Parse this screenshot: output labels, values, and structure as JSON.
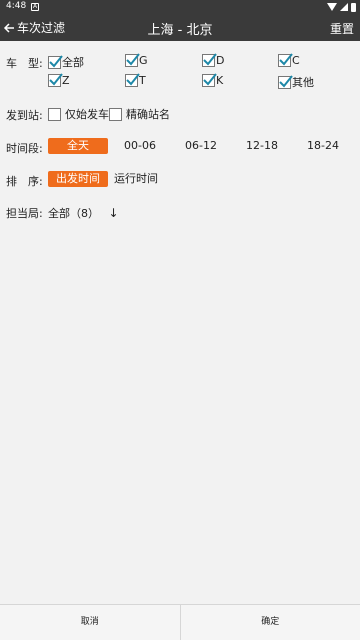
{
  "status": {
    "time": "4:48",
    "notif": "A"
  },
  "appbar": {
    "back_label": "车次过滤",
    "title": "上海 - 北京",
    "reset_label": "重置"
  },
  "train_type": {
    "label": "车　型:",
    "options": [
      {
        "label": "全部",
        "checked": true
      },
      {
        "label": "G",
        "checked": true
      },
      {
        "label": "D",
        "checked": true
      },
      {
        "label": "C",
        "checked": true
      },
      {
        "label": "Z",
        "checked": true
      },
      {
        "label": "T",
        "checked": true
      },
      {
        "label": "K",
        "checked": true
      },
      {
        "label": "其他",
        "checked": true
      }
    ]
  },
  "departure_station": {
    "label": "发到站:",
    "options": [
      {
        "label": "仅始发车",
        "checked": false
      },
      {
        "label": "精确站名",
        "checked": false
      }
    ]
  },
  "time_period": {
    "label": "时间段:",
    "options": [
      {
        "label": "全天",
        "active": true
      },
      {
        "label": "00-06",
        "active": false
      },
      {
        "label": "06-12",
        "active": false
      },
      {
        "label": "12-18",
        "active": false
      },
      {
        "label": "18-24",
        "active": false
      }
    ]
  },
  "sort": {
    "label": "排　序:",
    "options": [
      {
        "label": "出发时间",
        "active": true
      },
      {
        "label": "运行时间",
        "active": false
      }
    ]
  },
  "operator": {
    "label": "担当局:",
    "value": "全部（8）",
    "arrow": "↓"
  },
  "footer": {
    "cancel_label": "取消",
    "confirm_label": "确定"
  },
  "colors": {
    "accent": "#ef6c1c",
    "bar": "#3a3a3a",
    "check": "#1e88a8"
  }
}
